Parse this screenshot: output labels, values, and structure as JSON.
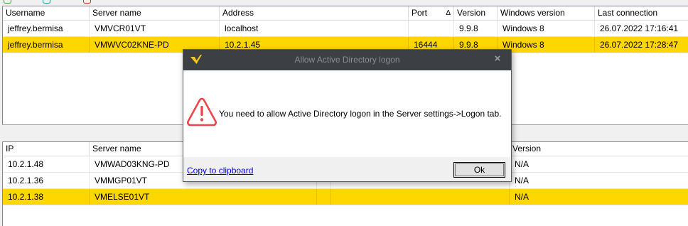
{
  "colors": {
    "selected_row": "#ffd700",
    "dialog_titlebar": "#3c3f43",
    "logo_yellow": "#f5c518",
    "warning_red": "#e8474b",
    "link_blue": "#0000e0"
  },
  "sessions_grid": {
    "columns": [
      "Username",
      "Server name",
      "Address",
      "Port",
      "Version",
      "Windows version",
      "Last connection"
    ],
    "sort_indicator": "Δ",
    "rows": [
      [
        "jeffrey.bermisa",
        "VMVCR01VT",
        "localhost",
        "",
        "9.9.8",
        "Windows 8",
        "26.07.2022 17:16:41"
      ],
      [
        "jeffrey.bermisa",
        "VMWVC02KNE-PD",
        "10.2.1.45",
        "16444",
        "9.9.8",
        "Windows 8",
        "26.07.2022 17:28:47"
      ]
    ]
  },
  "servers_grid": {
    "columns": [
      "IP",
      "Server name",
      "",
      "",
      "Version"
    ],
    "rows": [
      [
        "10.2.1.48",
        "VMWAD03KNG-PD",
        "",
        "",
        "N/A"
      ],
      [
        "10.2.1.36",
        "VMMGP01VT",
        "",
        "",
        "N/A"
      ],
      [
        "10.2.1.38",
        "VMELSE01VT",
        "",
        "",
        "N/A"
      ]
    ]
  },
  "dialog": {
    "title": "Allow Active Directory logon",
    "close_glyph": "×",
    "logo_icon": "v-logo-icon",
    "warning_icon": "warning-triangle-icon",
    "message": "You need to allow Active Directory logon in the Server settings->Logon tab.",
    "copy_link": "Copy to clipboard",
    "ok_label": "Ok"
  }
}
